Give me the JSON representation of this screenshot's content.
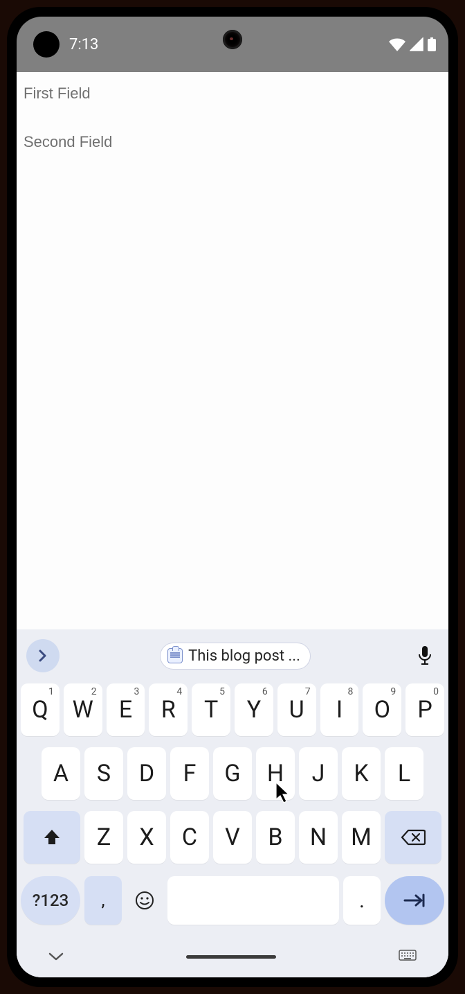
{
  "status": {
    "time": "7:13"
  },
  "fields": {
    "first": {
      "placeholder": "First Field",
      "value": ""
    },
    "second": {
      "placeholder": "Second Field",
      "value": ""
    }
  },
  "suggestion": {
    "text": "This blog post ..."
  },
  "keyboard": {
    "row1": [
      {
        "char": "Q",
        "hint": "1"
      },
      {
        "char": "W",
        "hint": "2"
      },
      {
        "char": "E",
        "hint": "3"
      },
      {
        "char": "R",
        "hint": "4"
      },
      {
        "char": "T",
        "hint": "5"
      },
      {
        "char": "Y",
        "hint": "6"
      },
      {
        "char": "U",
        "hint": "7"
      },
      {
        "char": "I",
        "hint": "8"
      },
      {
        "char": "O",
        "hint": "9"
      },
      {
        "char": "P",
        "hint": "0"
      }
    ],
    "row2": [
      "A",
      "S",
      "D",
      "F",
      "G",
      "H",
      "J",
      "K",
      "L"
    ],
    "row3": [
      "Z",
      "X",
      "C",
      "V",
      "B",
      "N",
      "M"
    ],
    "mode_label": "?123",
    "comma": ",",
    "period": "."
  }
}
